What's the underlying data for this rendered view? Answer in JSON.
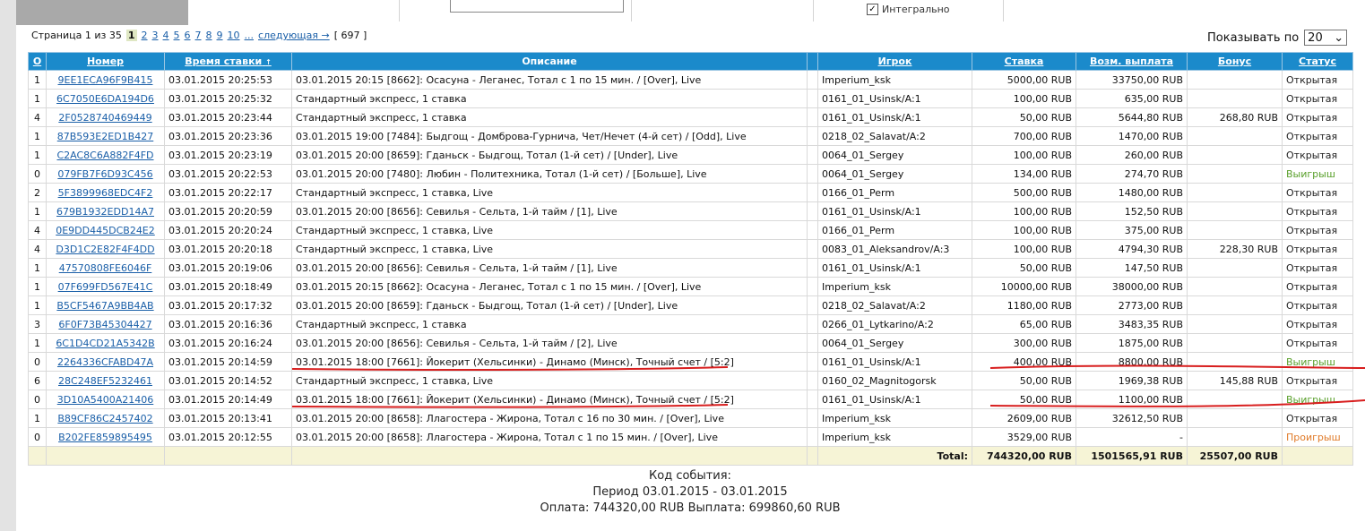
{
  "filter": {
    "integral_label": "Интегрально",
    "integral_checked": true
  },
  "pager": {
    "prefix": "Страница 1 из 35",
    "current": "1",
    "pages": [
      "2",
      "3",
      "4",
      "5",
      "6",
      "7",
      "8",
      "9",
      "10",
      "..."
    ],
    "next": "следующая →",
    "total": "[ 697 ]"
  },
  "show": {
    "label": "Показывать по",
    "value": "20"
  },
  "table": {
    "headers": {
      "o": "О",
      "number": "Номер",
      "time": "Время ставки",
      "desc": "Описание",
      "player": "Игрок",
      "stake": "Ставка",
      "payout": "Возм. выплата",
      "bonus": "Бонус",
      "status": "Статус"
    },
    "rows": [
      {
        "o": "1",
        "number": "9EE1ECA96F9B415",
        "time": "03.01.2015 20:25:53",
        "desc": "03.01.2015 20:15 [8662]: Осасуна - Леганес, Тотал с 1 по 15 мин. / [Over], Live",
        "player": "Imperium_ksk",
        "stake": "5000,00 RUB",
        "payout": "33750,00 RUB",
        "bonus": "",
        "status": "Открытая",
        "kind": "open"
      },
      {
        "o": "1",
        "number": "6C7050E6DA194D6",
        "time": "03.01.2015 20:25:32",
        "desc": "Стандартный экспресс, 1 ставка",
        "player": "0161_01_Usinsk/A:1",
        "stake": "100,00 RUB",
        "payout": "635,00 RUB",
        "bonus": "",
        "status": "Открытая",
        "kind": "open"
      },
      {
        "o": "4",
        "number": "2F0528740469449",
        "time": "03.01.2015 20:23:44",
        "desc": "Стандартный экспресс, 1 ставка",
        "player": "0161_01_Usinsk/A:1",
        "stake": "50,00 RUB",
        "payout": "5644,80 RUB",
        "bonus": "268,80 RUB",
        "status": "Открытая",
        "kind": "open"
      },
      {
        "o": "1",
        "number": "87B593E2ED1B427",
        "time": "03.01.2015 20:23:36",
        "desc": "03.01.2015 19:00 [7484]: Быдгощ - Домброва-Гурнича, Чет/Нечет (4-й сет) / [Odd], Live",
        "player": "0218_02_Salavat/A:2",
        "stake": "700,00 RUB",
        "payout": "1470,00 RUB",
        "bonus": "",
        "status": "Открытая",
        "kind": "open"
      },
      {
        "o": "1",
        "number": "C2AC8C6A882F4FD",
        "time": "03.01.2015 20:23:19",
        "desc": "03.01.2015 20:00 [8659]: Гданьск - Быдгощ, Тотал (1-й сет) / [Under], Live",
        "player": "0064_01_Sergey",
        "stake": "100,00 RUB",
        "payout": "260,00 RUB",
        "bonus": "",
        "status": "Открытая",
        "kind": "open"
      },
      {
        "o": "0",
        "number": "079FB7F6D93C456",
        "time": "03.01.2015 20:22:53",
        "desc": "03.01.2015 20:00 [7480]: Любин - Политехника, Тотал (1-й сет) / [Больше], Live",
        "player": "0064_01_Sergey",
        "stake": "134,00 RUB",
        "payout": "274,70 RUB",
        "bonus": "",
        "status": "Выигрыш",
        "kind": "win"
      },
      {
        "o": "2",
        "number": "5F3899968EDC4F2",
        "time": "03.01.2015 20:22:17",
        "desc": "Стандартный экспресс, 1 ставка, Live",
        "player": "0166_01_Perm",
        "stake": "500,00 RUB",
        "payout": "1480,00 RUB",
        "bonus": "",
        "status": "Открытая",
        "kind": "open"
      },
      {
        "o": "1",
        "number": "679B1932EDD14A7",
        "time": "03.01.2015 20:20:59",
        "desc": "03.01.2015 20:00 [8656]: Севилья - Сельта, 1-й тайм / [1], Live",
        "player": "0161_01_Usinsk/A:1",
        "stake": "100,00 RUB",
        "payout": "152,50 RUB",
        "bonus": "",
        "status": "Открытая",
        "kind": "open"
      },
      {
        "o": "4",
        "number": "0E9DD445DCB24E2",
        "time": "03.01.2015 20:20:24",
        "desc": "Стандартный экспресс, 1 ставка, Live",
        "player": "0166_01_Perm",
        "stake": "100,00 RUB",
        "payout": "375,00 RUB",
        "bonus": "",
        "status": "Открытая",
        "kind": "open"
      },
      {
        "o": "4",
        "number": "D3D1C2E82F4F4DD",
        "time": "03.01.2015 20:20:18",
        "desc": "Стандартный экспресс, 1 ставка, Live",
        "player": "0083_01_Aleksandrov/A:3",
        "stake": "100,00 RUB",
        "payout": "4794,30 RUB",
        "bonus": "228,30 RUB",
        "status": "Открытая",
        "kind": "open"
      },
      {
        "o": "1",
        "number": "47570808FE6046F",
        "time": "03.01.2015 20:19:06",
        "desc": "03.01.2015 20:00 [8656]: Севилья - Сельта, 1-й тайм / [1], Live",
        "player": "0161_01_Usinsk/A:1",
        "stake": "50,00 RUB",
        "payout": "147,50 RUB",
        "bonus": "",
        "status": "Открытая",
        "kind": "open"
      },
      {
        "o": "1",
        "number": "07F699FD567E41C",
        "time": "03.01.2015 20:18:49",
        "desc": "03.01.2015 20:15 [8662]: Осасуна - Леганес, Тотал с 1 по 15 мин. / [Over], Live",
        "player": "Imperium_ksk",
        "stake": "10000,00 RUB",
        "payout": "38000,00 RUB",
        "bonus": "",
        "status": "Открытая",
        "kind": "open"
      },
      {
        "o": "1",
        "number": "B5CF5467A9BB4AB",
        "time": "03.01.2015 20:17:32",
        "desc": "03.01.2015 20:00 [8659]: Гданьск - Быдгощ, Тотал (1-й сет) / [Under], Live",
        "player": "0218_02_Salavat/A:2",
        "stake": "1180,00 RUB",
        "payout": "2773,00 RUB",
        "bonus": "",
        "status": "Открытая",
        "kind": "open"
      },
      {
        "o": "3",
        "number": "6F0F73B45304427",
        "time": "03.01.2015 20:16:36",
        "desc": "Стандартный экспресс, 1 ставка",
        "player": "0266_01_Lytkarino/A:2",
        "stake": "65,00 RUB",
        "payout": "3483,35 RUB",
        "bonus": "",
        "status": "Открытая",
        "kind": "open"
      },
      {
        "o": "1",
        "number": "6C1D4CD21A5342B",
        "time": "03.01.2015 20:16:24",
        "desc": "03.01.2015 20:00 [8656]: Севилья - Сельта, 1-й тайм / [2], Live",
        "player": "0064_01_Sergey",
        "stake": "300,00 RUB",
        "payout": "1875,00 RUB",
        "bonus": "",
        "status": "Открытая",
        "kind": "open"
      },
      {
        "o": "0",
        "number": "2264336CFABD47A",
        "time": "03.01.2015 20:14:59",
        "desc": "03.01.2015 18:00 [7661]: Йокерит (Хельсинки) - Динамо (Минск), Точный счет / [5:2]",
        "player": "0161_01_Usinsk/A:1",
        "stake": "400,00 RUB",
        "payout": "8800,00 RUB",
        "bonus": "",
        "status": "Выигрыш",
        "kind": "win"
      },
      {
        "o": "6",
        "number": "28C248EF5232461",
        "time": "03.01.2015 20:14:52",
        "desc": "Стандартный экспресс, 1 ставка, Live",
        "player": "0160_02_Magnitogorsk",
        "stake": "50,00 RUB",
        "payout": "1969,38 RUB",
        "bonus": "145,88 RUB",
        "status": "Открытая",
        "kind": "open"
      },
      {
        "o": "0",
        "number": "3D10A5400A21406",
        "time": "03.01.2015 20:14:49",
        "desc": "03.01.2015 18:00 [7661]: Йокерит (Хельсинки) - Динамо (Минск), Точный счет / [5:2]",
        "player": "0161_01_Usinsk/A:1",
        "stake": "50,00 RUB",
        "payout": "1100,00 RUB",
        "bonus": "",
        "status": "Выигрыш",
        "kind": "win"
      },
      {
        "o": "1",
        "number": "B89CF86C2457402",
        "time": "03.01.2015 20:13:41",
        "desc": "03.01.2015 20:00 [8658]: Ллагостера - Жирона, Тотал с 16 по 30 мин. / [Over], Live",
        "player": "Imperium_ksk",
        "stake": "2609,00 RUB",
        "payout": "32612,50 RUB",
        "bonus": "",
        "status": "Открытая",
        "kind": "open"
      },
      {
        "o": "0",
        "number": "B202FE859895495",
        "time": "03.01.2015 20:12:55",
        "desc": "03.01.2015 20:00 [8658]: Ллагостера - Жирона, Тотал с 1 по 15 мин. / [Over], Live",
        "player": "Imperium_ksk",
        "stake": "3529,00 RUB",
        "payout": "-",
        "bonus": "",
        "status": "Проигрыш",
        "kind": "lose"
      }
    ],
    "total": {
      "label": "Total:",
      "stake": "744320,00 RUB",
      "payout": "1501565,91 RUB",
      "bonus": "25507,00 RUB"
    }
  },
  "summary": {
    "line1": "Код события:",
    "line2": "Период 03.01.2015 - 03.01.2015",
    "line3": "Оплата: 744320,00 RUB Выплата: 699860,60 RUB"
  },
  "colors": {
    "header": "#1b8acb",
    "link": "#1a5fa8",
    "win": "#5aa02c",
    "lose": "#e07b2a",
    "annotation": "#d81e1e"
  }
}
